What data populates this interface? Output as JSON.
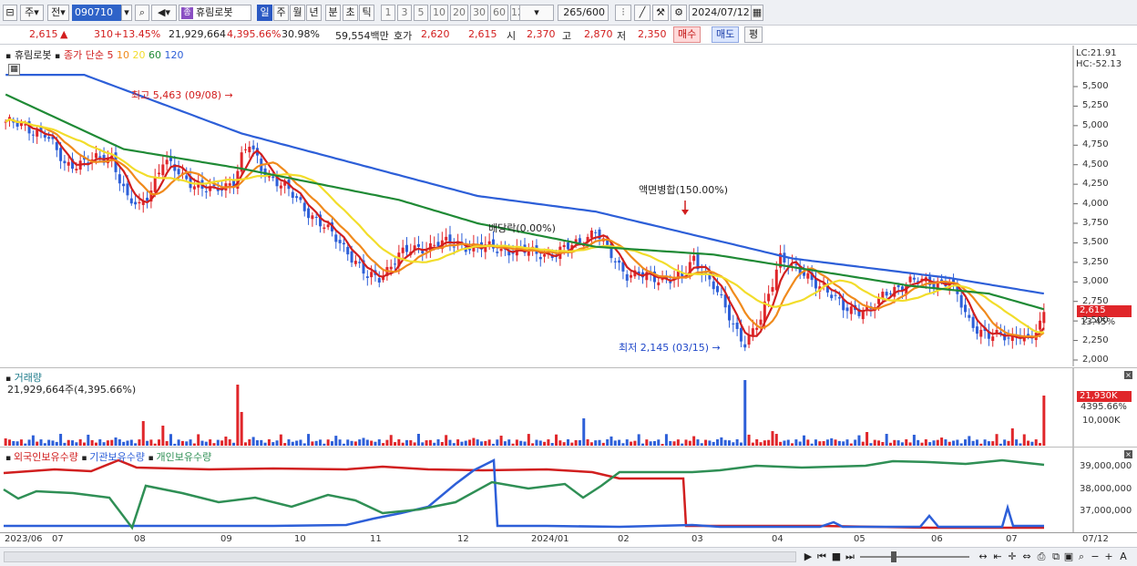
{
  "toolbar": {
    "period_label": "주",
    "jeon_label": "전",
    "code_value": "090710",
    "stock_name": "휴림로봇",
    "stock_badge": "종",
    "periods": [
      "일",
      "주",
      "월",
      "년",
      "분",
      "초",
      "틱"
    ],
    "active_period": "일",
    "intervals": [
      "1",
      "3",
      "5",
      "10",
      "20",
      "30",
      "60",
      "120"
    ],
    "count_value": "265",
    "count_total": "/600",
    "date_value": "2024/07/12"
  },
  "quote": {
    "price": "2,615",
    "change_mark": "▲",
    "change": "310",
    "change_rate": "+13.45%",
    "volume": "21,929,664",
    "volume_rate": "4,395.66%",
    "turnover": "30.98%",
    "amount": "59,554백만",
    "hoga_label": "호가",
    "ask": "2,620",
    "bid": "2,615",
    "open_label": "시",
    "open": "2,370",
    "high_label": "고",
    "high": "2,870",
    "low_label": "저",
    "low": "2,350",
    "buy_label": "매수",
    "sell_label": "매도",
    "eval_label": "평"
  },
  "price_panel": {
    "name_label": "휴림로봇",
    "ma_label": "종가 단순",
    "ma_periods": [
      "5",
      "10",
      "20",
      "60",
      "120"
    ],
    "ma_colors": [
      "#d11f1f",
      "#f08a1c",
      "#f2dd2b",
      "#1f8a35",
      "#2d5fd8"
    ],
    "lc_label": "LC:21.91",
    "hc_label": "HC:-52.13",
    "current_price": "2,615",
    "current_rate": "13.45%",
    "high_annotation": "최고 5,463 (09/08)",
    "low_annotation": "최저 2,145 (03/15)",
    "event_split": "액면병합(150.00%)",
    "event_dividend": "배당락(0.00%)",
    "y_ticks": [
      "5,500",
      "5,250",
      "5,000",
      "4,750",
      "4,500",
      "4,250",
      "4,000",
      "3,750",
      "3,500",
      "3,250",
      "3,000",
      "2,750",
      "2,500",
      "2,250",
      "2,000"
    ]
  },
  "volume_panel": {
    "title": "거래량",
    "info": "21,929,664주(4,395.66%)",
    "current_value": "21,930K",
    "current_rate": "4395.66%",
    "y_tick": "10,000K"
  },
  "holding_panel": {
    "legend": [
      "외국인보유수량",
      "기관보유수량",
      "개인보유수량"
    ],
    "legend_colors": [
      "#d11f1f",
      "#2d5fd8",
      "#2f8f55"
    ],
    "y_ticks": [
      "39,000,000",
      "38,000,000",
      "37,000,000"
    ]
  },
  "x_axis": {
    "labels": [
      "2023/06",
      "07",
      "08",
      "09",
      "10",
      "11",
      "12",
      "2024/01",
      "02",
      "03",
      "04",
      "05",
      "06",
      "07"
    ],
    "right_label": "07/12"
  }
}
